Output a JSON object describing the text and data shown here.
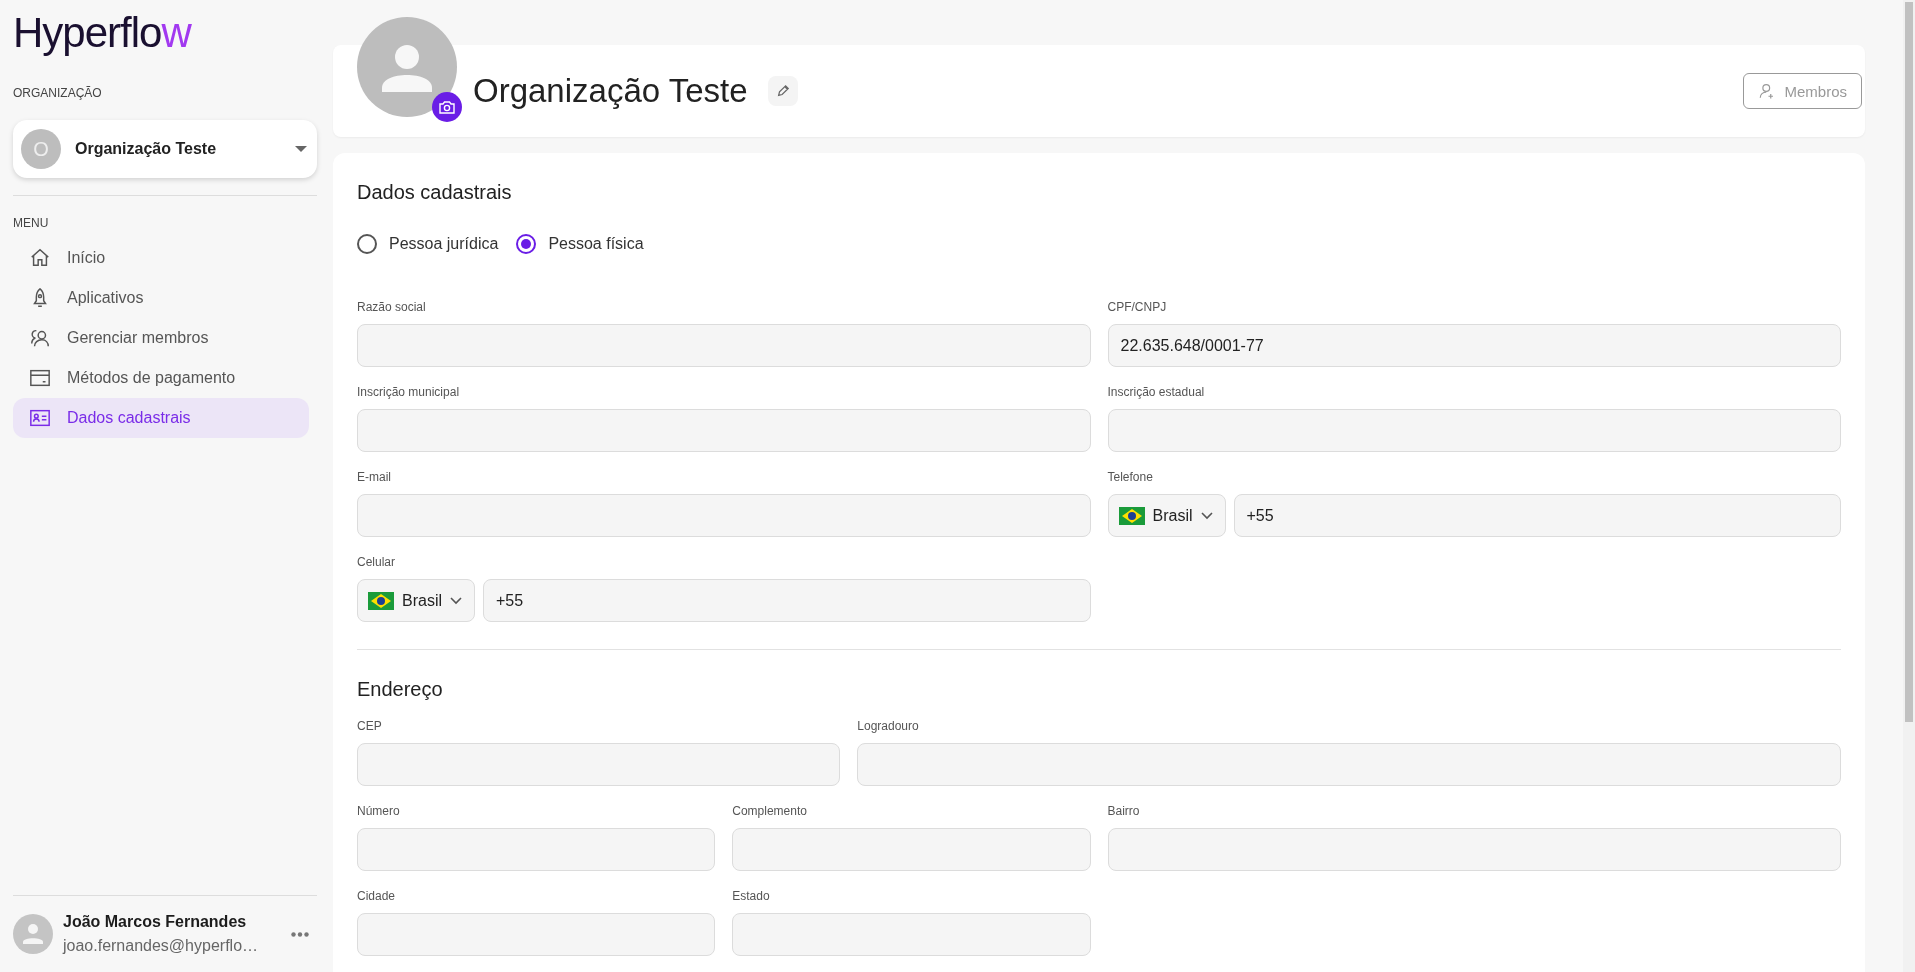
{
  "sidebar": {
    "logo": "Hyperflow",
    "organization_label": "ORGANIZAÇÃO",
    "organization": {
      "initial": "O",
      "name": "Organização Teste"
    },
    "menu_label": "MENU",
    "menu": [
      {
        "label": "Início",
        "selected": false
      },
      {
        "label": "Aplicativos",
        "selected": false
      },
      {
        "label": "Gerenciar membros",
        "selected": false
      },
      {
        "label": "Métodos de pagamento",
        "selected": false
      },
      {
        "label": "Dados cadastrais",
        "selected": true
      }
    ],
    "user": {
      "name": "João Marcos Fernandes",
      "email": "joao.fernandes@hyperflo…"
    }
  },
  "header": {
    "title": "Organização Teste",
    "members_button": "Membros"
  },
  "registration": {
    "title": "Dados cadastrais",
    "person_types": [
      {
        "label": "Pessoa jurídica",
        "selected": false
      },
      {
        "label": "Pessoa física",
        "selected": true
      }
    ],
    "fields": [
      {
        "label": "Razão social",
        "kind": "text"
      },
      {
        "label": "CPF/CNPJ",
        "kind": "text",
        "value": "22.635.648/0001-77"
      },
      {
        "label": "Inscrição municipal",
        "kind": "text"
      },
      {
        "label": "Inscrição estadual",
        "kind": "text"
      },
      {
        "label": "E-mail",
        "kind": "text"
      },
      {
        "label": "Telefone",
        "kind": "phone",
        "country": "Brasil",
        "value": "+55"
      },
      {
        "label": "Celular",
        "kind": "phone",
        "country": "Brasil",
        "value": "+55"
      }
    ]
  },
  "address": {
    "title": "Endereço",
    "fields": [
      {
        "label": "CEP",
        "kind": "text"
      },
      {
        "label": "Logradouro",
        "kind": "text"
      },
      {
        "label": "Número",
        "kind": "text"
      },
      {
        "label": "Complemento",
        "kind": "text"
      },
      {
        "label": "Bairro",
        "kind": "text"
      },
      {
        "label": "Cidade",
        "kind": "text"
      },
      {
        "label": "Estado",
        "kind": "text"
      }
    ]
  }
}
